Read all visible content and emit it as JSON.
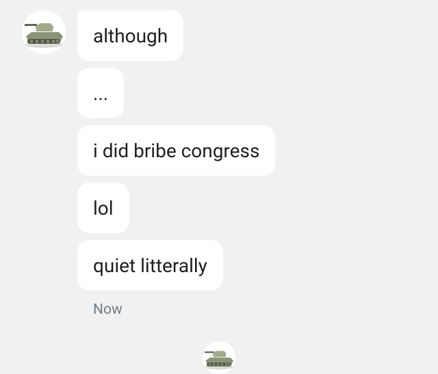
{
  "conversation": {
    "contact_avatar_icon": "tank-avatar-icon",
    "messages": [
      {
        "text": "although"
      },
      {
        "text": "..."
      },
      {
        "text": "i did bribe congress"
      },
      {
        "text": "lol"
      },
      {
        "text": "quiet litterally"
      }
    ],
    "timestamp": "Now",
    "seen_avatar_icon": "tank-avatar-icon"
  },
  "colors": {
    "background": "#f1f1f1",
    "bubble": "#ffffff",
    "text": "#1c1e21",
    "timestamp": "#707c86"
  }
}
